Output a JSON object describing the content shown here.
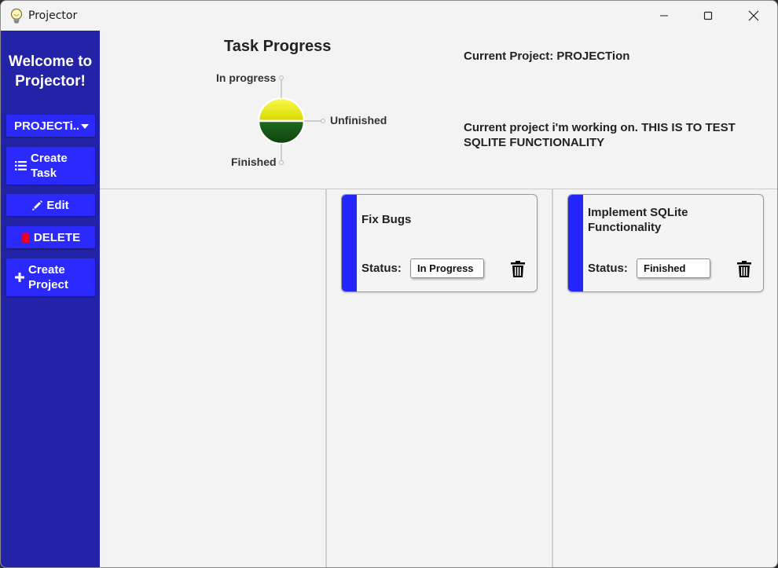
{
  "window": {
    "title": "Projector",
    "icon": "lightbulb-icon"
  },
  "sidebar": {
    "welcome_line1": "Welcome to",
    "welcome_line2": "Projector!",
    "project_select": "PROJECTi..",
    "create_task_line1": "Create",
    "create_task_line2": "Task",
    "edit": "Edit",
    "delete": "DELETE",
    "create_project_line1": "Create",
    "create_project_line2": "Project",
    "accent_color": "#2a2aff",
    "background_color": "#2323a8"
  },
  "header": {
    "current_project": "Current Project: PROJECTion",
    "description_line1": "Current project i'm working on. THIS IS TO TEST",
    "description_line2": "SQLITE FUNCTIONALITY"
  },
  "chart_data": {
    "type": "pie",
    "title": "Task Progress",
    "categories": [
      "In progress",
      "Unfinished",
      "Finished"
    ],
    "values": [
      1,
      0,
      1
    ],
    "colors": [
      "#e6e600",
      "#ffffff",
      "#1a5c1a"
    ]
  },
  "tasks": [
    {
      "name_line1": "Fix Bugs",
      "name_line2": "",
      "status_label": "Status:",
      "status": "In Progress"
    },
    {
      "name_line1": "Implement SQLite",
      "name_line2": "Functionality",
      "status_label": "Status:",
      "status": "Finished"
    }
  ]
}
